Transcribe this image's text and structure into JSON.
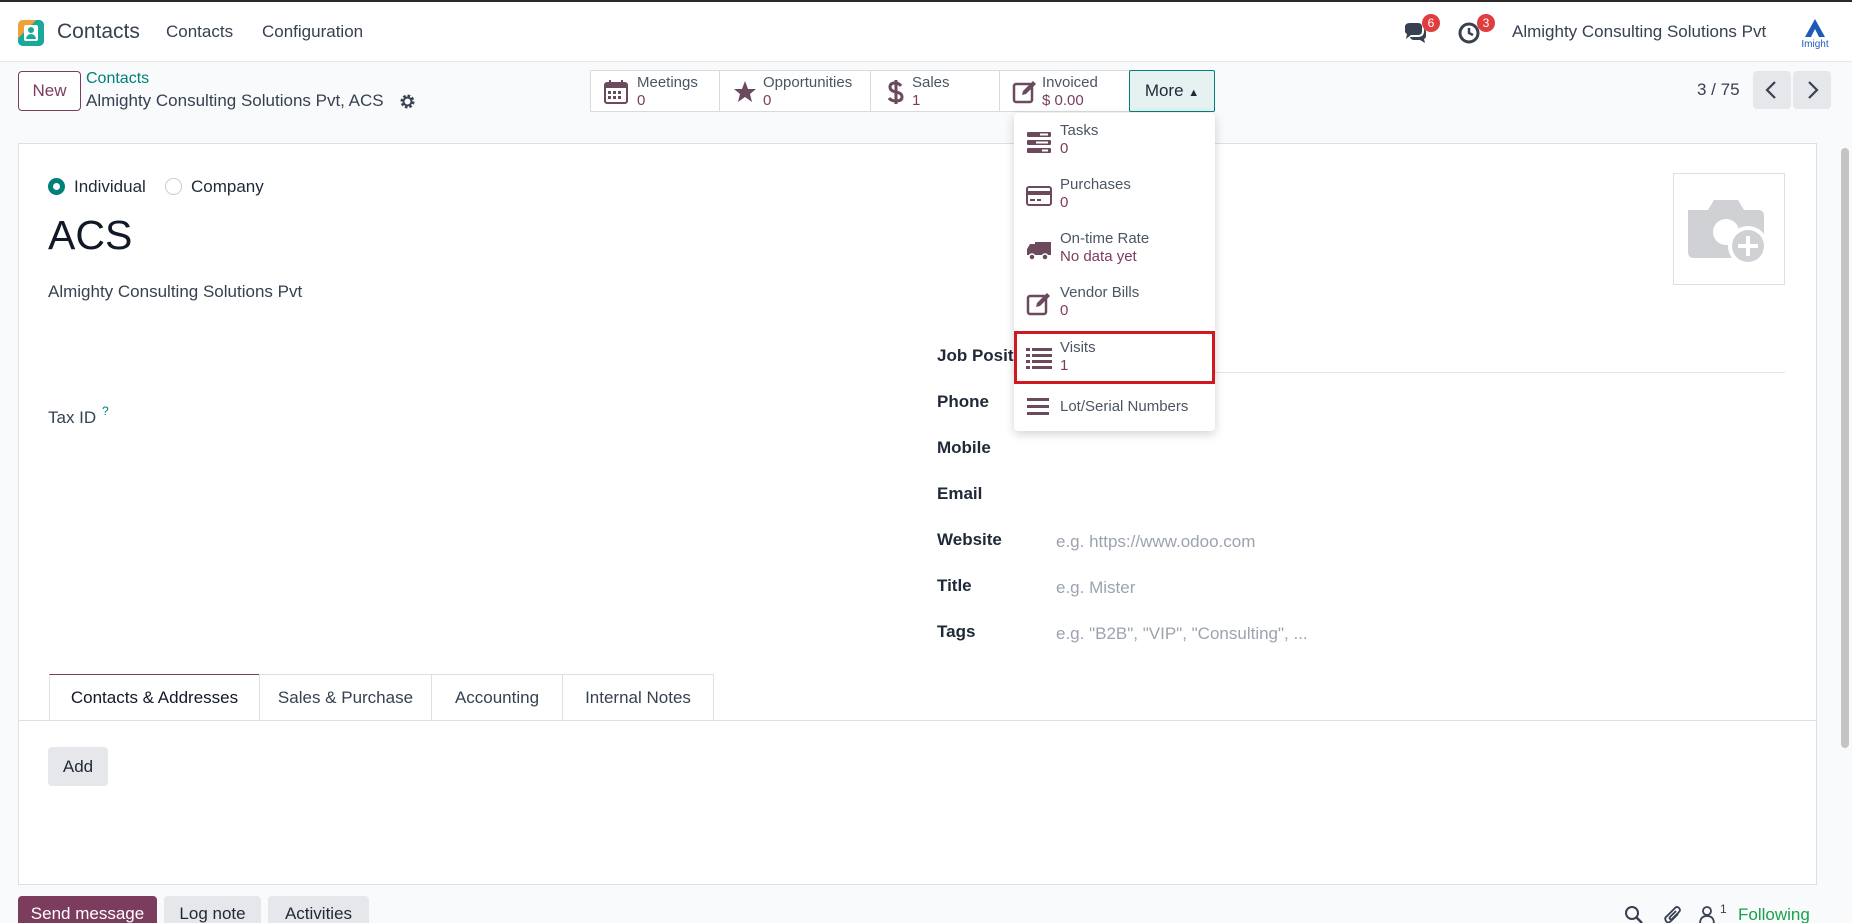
{
  "navbar": {
    "app_name": "Contacts",
    "menu": [
      "Contacts",
      "Configuration"
    ],
    "messages_badge": "6",
    "activities_badge": "3",
    "company": "Almighty Consulting Solutions Pvt",
    "logo_text": "Imight"
  },
  "control_panel": {
    "new_label": "New",
    "breadcrumb_parent": "Contacts",
    "breadcrumb_current": "Almighty Consulting Solutions Pvt, ACS",
    "pager": "3 / 75",
    "more_label": "More"
  },
  "smart_buttons": [
    {
      "label": "Meetings",
      "value": "0",
      "icon": "calendar-icon"
    },
    {
      "label": "Opportunities",
      "value": "0",
      "icon": "star-icon"
    },
    {
      "label": "Sales",
      "value": "1",
      "icon": "dollar-icon"
    },
    {
      "label": "Invoiced",
      "value": "$ 0.00",
      "icon": "edit-icon"
    }
  ],
  "dropdown": [
    {
      "label": "Tasks",
      "value": "0",
      "icon": "tasks-icon"
    },
    {
      "label": "Purchases",
      "value": "0",
      "icon": "credit-card-icon"
    },
    {
      "label": "On-time Rate",
      "value": "No data yet",
      "icon": "truck-icon"
    },
    {
      "label": "Vendor Bills",
      "value": "0",
      "icon": "edit-icon"
    },
    {
      "label": "Visits",
      "value": "1",
      "icon": "list-icon"
    },
    {
      "label": "Lot/Serial Numbers",
      "value": "",
      "icon": "bars-icon"
    }
  ],
  "form": {
    "type_individual": "Individual",
    "type_company": "Company",
    "selected_type": "Individual",
    "name": "ACS",
    "company_name": "Almighty Consulting Solutions Pvt",
    "tax_label": "Tax ID",
    "tax_help": "?",
    "job_position_label": "Job Posit",
    "phone_label": "Phone",
    "mobile_label": "Mobile",
    "email_label": "Email",
    "website_label": "Website",
    "website_placeholder": "e.g. https://www.odoo.com",
    "title_label": "Title",
    "title_placeholder": "e.g. Mister",
    "tags_label": "Tags",
    "tags_placeholder": "e.g. \"B2B\", \"VIP\", \"Consulting\", ..."
  },
  "tabs": [
    "Contacts & Addresses",
    "Sales & Purchase",
    "Accounting",
    "Internal Notes"
  ],
  "add_label": "Add",
  "chatter": {
    "send_message": "Send message",
    "log_note": "Log note",
    "activities": "Activities",
    "followers_count": "1",
    "following": "Following"
  },
  "colors": {
    "primary": "#7c3c5e",
    "teal": "#01807a",
    "highlight": "#d0181f"
  }
}
